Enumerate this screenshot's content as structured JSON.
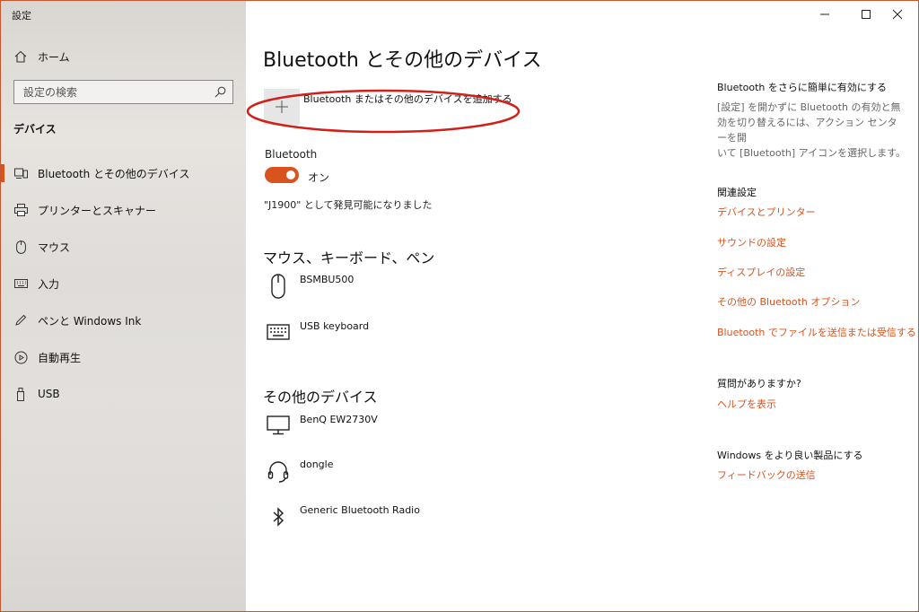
{
  "window": {
    "app_title": "設定",
    "controls": {
      "minimize_icon": "minimize-icon",
      "maximize_icon": "maximize-icon",
      "close_icon": "close-icon"
    }
  },
  "sidebar": {
    "home_label": "ホーム",
    "search_placeholder": "設定の検索",
    "section_label": "デバイス",
    "items": [
      {
        "label": "Bluetooth とその他のデバイス",
        "icon": "bluetooth-devices-icon",
        "selected": true
      },
      {
        "label": "プリンターとスキャナー",
        "icon": "printer-icon"
      },
      {
        "label": "マウス",
        "icon": "mouse-icon"
      },
      {
        "label": "入力",
        "icon": "keyboard-icon"
      },
      {
        "label": "ペンと Windows Ink",
        "icon": "pen-icon"
      },
      {
        "label": "自動再生",
        "icon": "autoplay-icon"
      },
      {
        "label": "USB",
        "icon": "usb-icon"
      }
    ]
  },
  "main": {
    "title": "Bluetooth とその他のデバイス",
    "add_device_label": "Bluetooth またはその他のデバイスを追加する",
    "bluetooth_label": "Bluetooth",
    "toggle_state": "オン",
    "toggle_on": true,
    "discoverable_text": "\"J1900\" として発見可能になりました",
    "groups": [
      {
        "heading": "マウス、キーボード、ペン",
        "devices": [
          {
            "name": "BSMBU500",
            "icon": "mouse-icon"
          },
          {
            "name": "USB keyboard",
            "icon": "keyboard-icon"
          }
        ]
      },
      {
        "heading": "その他のデバイス",
        "devices": [
          {
            "name": "BenQ EW2730V",
            "icon": "monitor-icon"
          },
          {
            "name": "dongle",
            "icon": "headset-icon"
          },
          {
            "name": "Generic Bluetooth Radio",
            "icon": "bluetooth-icon"
          }
        ]
      }
    ]
  },
  "right": {
    "tip_heading": "Bluetooth をさらに簡単に有効にする",
    "tip_lines": [
      "[設定] を開かずに Bluetooth の有効と無",
      "効を切り替えるには、アクション センターを開",
      "いて [Bluetooth] アイコンを選択します。"
    ],
    "related_heading": "関連設定",
    "related_links": [
      "デバイスとプリンター",
      "サウンドの設定",
      "ディスプレイの設定",
      "その他の Bluetooth オプション",
      "Bluetooth でファイルを送信または受信する"
    ],
    "question_heading": "質問がありますか?",
    "help_link": "ヘルプを表示",
    "improve_heading": "Windows をより良い製品にする",
    "feedback_link": "フィードバックの送信"
  },
  "colors": {
    "accent": "#d9531e",
    "annotation": "#d0201a"
  }
}
